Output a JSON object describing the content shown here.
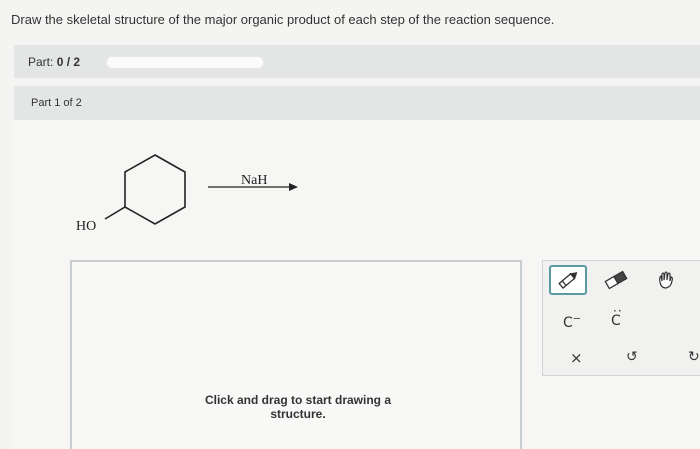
{
  "header": {
    "instruction": "Draw the skeletal structure of the major organic product of each step of the reaction sequence."
  },
  "part_bar": {
    "prefix": "Part:",
    "score": "0 / 2",
    "progress_fraction": 0
  },
  "subpart": {
    "label": "Part 1 of 2"
  },
  "reaction": {
    "substituent": "HO",
    "reagent": "NaH"
  },
  "canvas": {
    "hint": "Click and drag to start drawing a structure."
  },
  "toolbox": {
    "charge_minus_label": "C",
    "charge_minus_sup": "−",
    "lone_pair_label": "C",
    "lone_pair_dots": "̈",
    "delete_label": "×",
    "undo_label": "↺",
    "redo_label": "↻",
    "icons": [
      "pencil-icon",
      "eraser-icon",
      "hand-icon",
      "charge-minus-icon",
      "lone-pair-icon",
      "delete-icon",
      "undo-icon",
      "redo-icon"
    ]
  }
}
